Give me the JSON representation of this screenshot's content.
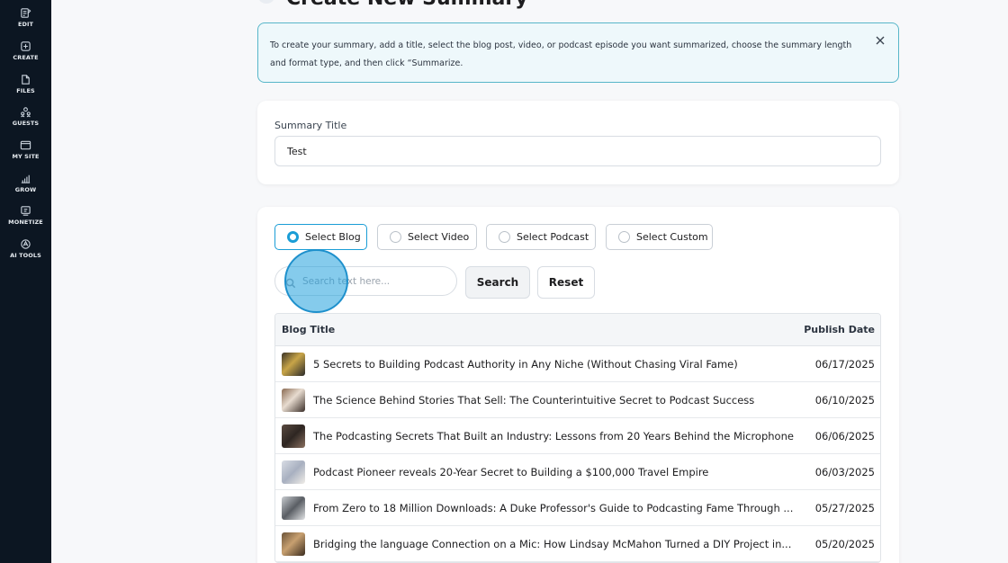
{
  "sidebar": {
    "items": [
      {
        "label": "EDIT",
        "icon": "edit-icon"
      },
      {
        "label": "CREATE",
        "icon": "create-icon"
      },
      {
        "label": "FILES",
        "icon": "files-icon"
      },
      {
        "label": "GUESTS",
        "icon": "guests-icon"
      },
      {
        "label": "MY SITE",
        "icon": "site-icon"
      },
      {
        "label": "GROW",
        "icon": "grow-icon"
      },
      {
        "label": "MONETIZE",
        "icon": "monetize-icon"
      },
      {
        "label": "AI TOOLS",
        "icon": "ai-tools-icon"
      }
    ]
  },
  "page": {
    "title": "Create New Summary"
  },
  "banner": {
    "text": "To create your summary, add a title, select the blog post, video, or podcast episode you want summarized, choose the summary length and format type, and then click “Summarize."
  },
  "summary_title": {
    "label": "Summary Title",
    "value": "Test"
  },
  "source_options": [
    {
      "label": "Select Blog",
      "selected": true
    },
    {
      "label": "Select Video",
      "selected": false
    },
    {
      "label": "Select Podcast",
      "selected": false
    },
    {
      "label": "Select Custom",
      "selected": false
    }
  ],
  "search": {
    "placeholder": "Search text here...",
    "search_label": "Search",
    "reset_label": "Reset"
  },
  "table": {
    "columns": [
      "Blog Title",
      "Publish Date"
    ],
    "rows": [
      {
        "title": "5 Secrets to Building Podcast Authority in Any Niche (Without Chasing Viral Fame)",
        "date": "06/17/2025"
      },
      {
        "title": "The Science Behind Stories That Sell: The Counterintuitive Secret to Podcast Success",
        "date": "06/10/2025"
      },
      {
        "title": "The Podcasting Secrets That Built an Industry: Lessons from 20 Years Behind the Microphone",
        "date": "06/06/2025"
      },
      {
        "title": "Podcast Pioneer reveals 20-Year Secret to Building a $100,000 Travel Empire",
        "date": "06/03/2025"
      },
      {
        "title": "From Zero to 18 Million Downloads: A Duke Professor's Guide to Podcasting Fame Through ...",
        "date": "05/27/2025"
      },
      {
        "title": "Bridging the language Connection on a Mic: How Lindsay McMahon Turned a DIY Project in...",
        "date": "05/20/2025"
      }
    ]
  },
  "colors": {
    "sidebar_bg": "#0c1622",
    "accent": "#1a9dd6",
    "banner_border": "#57b6c9",
    "banner_bg": "#eef8fb"
  }
}
